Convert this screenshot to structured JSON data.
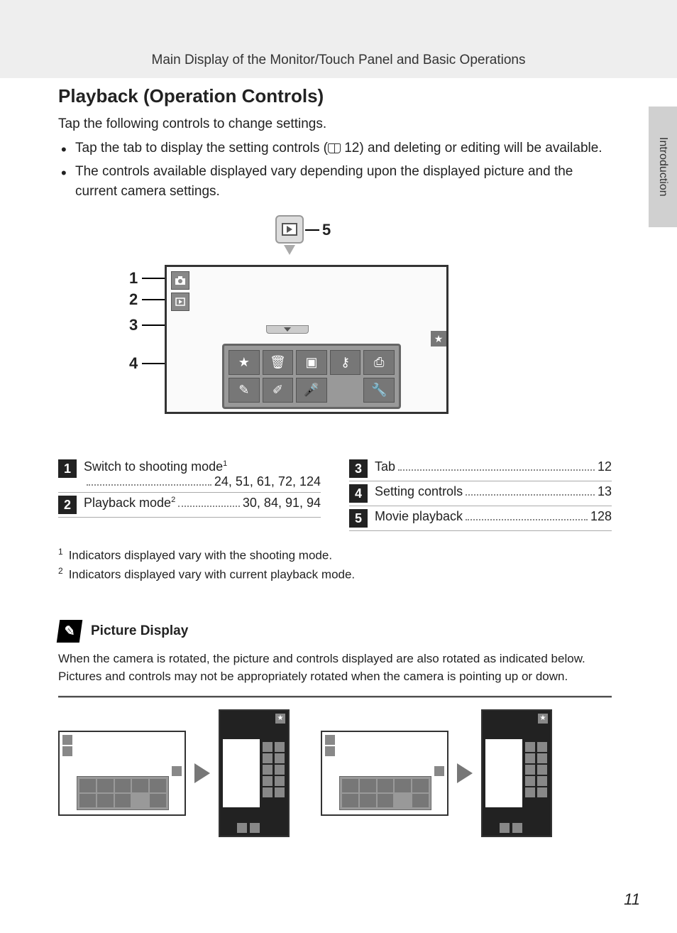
{
  "header": "Main Display of the Monitor/Touch Panel and Basic Operations",
  "sideTab": "Introduction",
  "title": "Playback (Operation Controls)",
  "intro": "Tap the following controls to change settings.",
  "bullets": [
    {
      "pre": "Tap the tab to display the setting controls (",
      "pageRef": "12",
      "post": ") and deleting or editing will be available."
    },
    {
      "pre": "The controls available displayed vary depending upon the displayed picture and the current camera settings.",
      "pageRef": "",
      "post": ""
    }
  ],
  "diagram": {
    "callouts": {
      "1": "1",
      "2": "2",
      "3": "3",
      "4": "4",
      "5": "5"
    }
  },
  "refs": {
    "left": [
      {
        "num": "1",
        "label": "Switch to shooting mode",
        "sup": "1",
        "pages": "24, 51, 61, 72, 124",
        "twoLine": true
      },
      {
        "num": "2",
        "label": "Playback mode",
        "sup": "2",
        "pages": "30, 84, 91, 94"
      }
    ],
    "right": [
      {
        "num": "3",
        "label": "Tab",
        "pages": "12"
      },
      {
        "num": "4",
        "label": "Setting controls",
        "pages": "13"
      },
      {
        "num": "5",
        "label": "Movie playback",
        "pages": "128"
      }
    ]
  },
  "footnotes": [
    {
      "sup": "1",
      "text": "Indicators displayed vary with the shooting mode."
    },
    {
      "sup": "2",
      "text": "Indicators displayed vary with current playback mode."
    }
  ],
  "pictureSection": {
    "title": "Picture Display",
    "desc1": "When the camera is rotated, the picture and controls displayed are also rotated as indicated below.",
    "desc2": "Pictures and controls may not be appropriately rotated when the camera is pointing up or down."
  },
  "pageNumber": "11"
}
